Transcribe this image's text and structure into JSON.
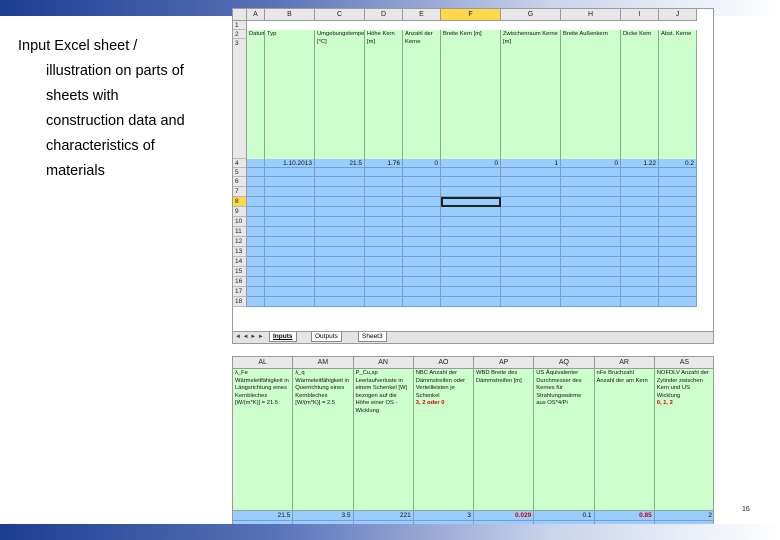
{
  "caption": {
    "line1": "Input Excel sheet /",
    "line2": "illustration on parts of",
    "line3": "sheets with",
    "line4": "construction data and",
    "line5": "characteristics of",
    "line6": "materials"
  },
  "sheet1": {
    "columns": [
      "A",
      "B",
      "C",
      "D",
      "E",
      "F",
      "G",
      "H",
      "I",
      "J"
    ],
    "selected_column": "F",
    "rows": [
      "1",
      "2",
      "3",
      "4",
      "5",
      "6",
      "7",
      "8",
      "9",
      "10",
      "11",
      "12",
      "13",
      "14",
      "15",
      "16",
      "17",
      "18"
    ],
    "selected_row": "8",
    "header_row": [
      "Datum",
      "Typ",
      "Umgebungstemperatur [°C]",
      "Höhe Kern [m]",
      "Anzahl der Kerne",
      "Breite Kern [m]",
      "Zwischenraum Kerne [m]",
      "Breite Außenkern",
      "Dicke Kern",
      "Abst. Kerne"
    ],
    "data_row": [
      "1.10.2013",
      "21.5",
      "1.76",
      "0",
      "0",
      "1",
      "0",
      "1.22",
      "0.2"
    ],
    "tabs": [
      "Inputs",
      "Outputs",
      "Sheet3"
    ],
    "active_tab": "Inputs",
    "nav": "◄ ◄ ► ►"
  },
  "sheet2": {
    "columns": [
      "AL",
      "AM",
      "AN",
      "AO",
      "AP",
      "AQ",
      "AR",
      "AS"
    ],
    "header_row": [
      "λ_Fe Wärmeleitfähigkeit in Längsrichtung eines Kernbleches [W/(m*K)] = 21.5",
      "λ_q Wärmeleitfähigkeit in Querrichtung eines Kernbleches [W/(m*K)] = 2.5",
      "P_Cu,sp Leerlaufverluste in einem Schenkel [W] bezogen auf die Höhe einer OS - Wicklung",
      "NBC Anzahl der Dämmstreifen oder Verteilleisten je Schenkel",
      "WBD Breite des Dämmstreifen [m]",
      "US Äquivalenter Durchmesser des Kernes für Strahlungswärme aus OS*4/Pi",
      "nFe Bruchzahl Anzahl der am Kern",
      "NOFDLV Anzahl der Zylinder zwischen Kern und US Wicklung"
    ],
    "red_notes": [
      "3, 2 oder 0",
      "0, 1, 2"
    ],
    "data_row": [
      "21.5",
      "3.5",
      "221",
      "3",
      "0.029",
      "0.1",
      "0.85",
      "2"
    ]
  },
  "page_number": "16",
  "colors": {
    "band_dark": "#1b3d91",
    "cell_green": "#ccffcc",
    "cell_blue": "#99ccff",
    "selected_header": "#ffd84a",
    "red_text": "#d00000"
  }
}
